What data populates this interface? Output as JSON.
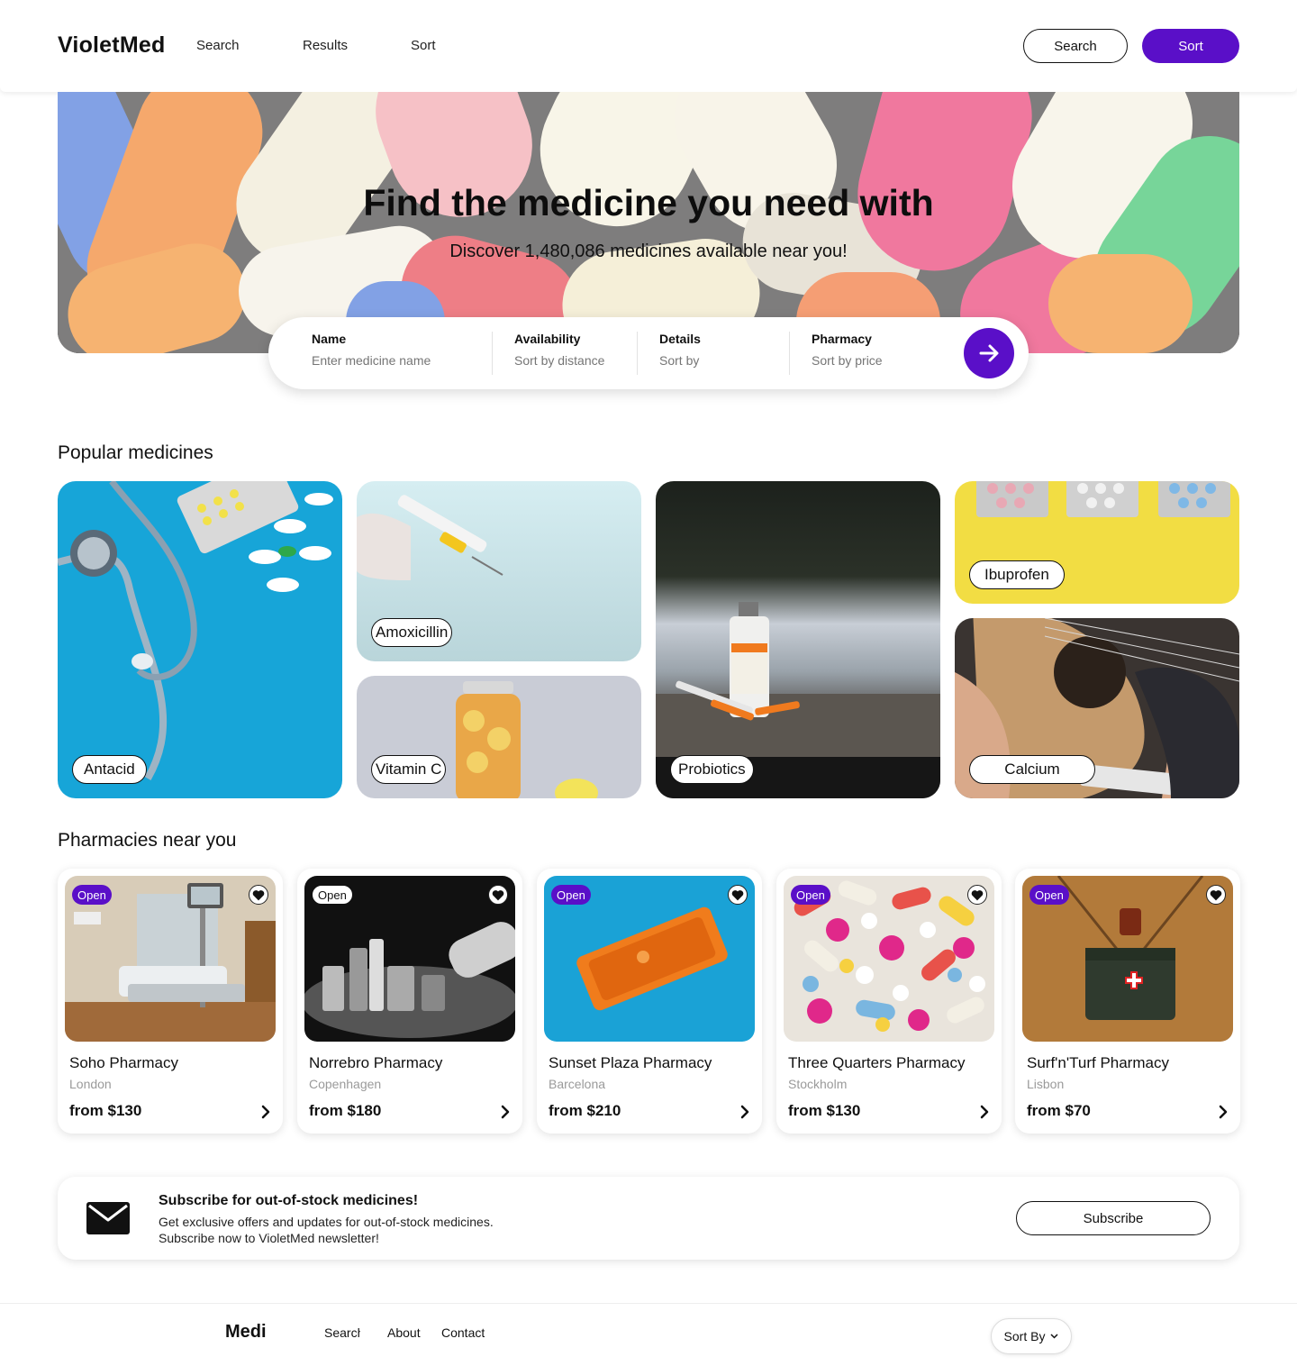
{
  "header": {
    "logo": "VioletMed",
    "nav": [
      "Search",
      "Results",
      "Sort"
    ],
    "search_button": "Search",
    "sort_button": "Sort"
  },
  "hero": {
    "title": "Find the medicine you need with",
    "subtitle": "Discover 1,480,086 medicines available near you!"
  },
  "search": {
    "fields": [
      {
        "label": "Name",
        "placeholder": "Enter medicine name"
      },
      {
        "label": "Availability",
        "placeholder": "Sort by distance"
      },
      {
        "label": "Details",
        "placeholder": "Sort by"
      },
      {
        "label": "Pharmacy",
        "placeholder": "Sort by price"
      }
    ],
    "submit_icon": "arrow-right-icon"
  },
  "popular": {
    "title": "Popular medicines",
    "items": [
      "Antacid",
      "Amoxicillin",
      "Vitamin C",
      "Probiotics",
      "Ibuprofen",
      "Calcium"
    ]
  },
  "pharmacies": {
    "title": "Pharmacies near you",
    "items": [
      {
        "status": "Open",
        "name": "Soho Pharmacy",
        "city": "London",
        "price": "from $130"
      },
      {
        "status": "Open",
        "name": "Norrebro Pharmacy",
        "city": "Copenhagen",
        "price": "from $180"
      },
      {
        "status": "Open",
        "name": "Sunset Plaza Pharmacy",
        "city": "Barcelona",
        "price": "from $210"
      },
      {
        "status": "Open",
        "name": "Three Quarters Pharmacy",
        "city": "Stockholm",
        "price": "from $130"
      },
      {
        "status": "Open",
        "name": "Surf'n'Turf Pharmacy",
        "city": "Lisbon",
        "price": "from $70"
      }
    ]
  },
  "subscribe": {
    "title": "Subscribe for out-of-stock medicines!",
    "line1": "Get exclusive offers and updates for out-of-stock medicines.",
    "line2": "Subscribe now to VioletMed newsletter!",
    "button": "Subscribe",
    "icon": "envelope-icon"
  },
  "footer": {
    "logo": "Medi",
    "links": [
      "Search",
      "About",
      "Contact"
    ],
    "sort": "Sort By"
  },
  "colors": {
    "accent": "#5a0fc8",
    "text": "#111111",
    "muted": "#9a9a9a"
  }
}
